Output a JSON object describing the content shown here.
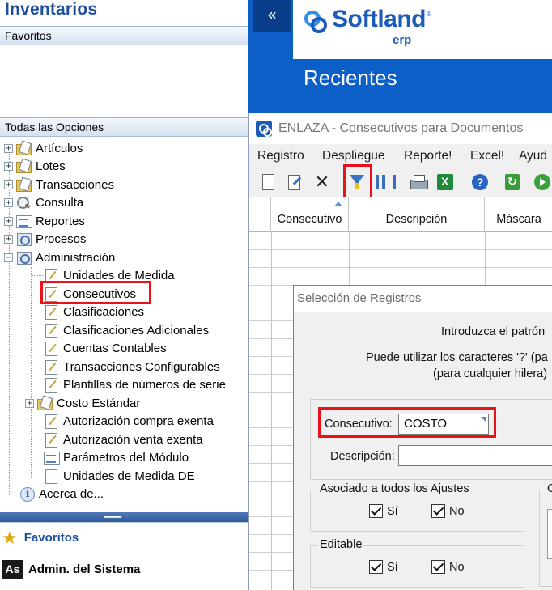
{
  "left_panel": {
    "app_title": "Inventarios",
    "favorites_header": "Favoritos",
    "all_options_header": "Todas las Opciones",
    "tree": [
      {
        "label": "Artículos",
        "expander": "+",
        "icon": "folder-doc-icon"
      },
      {
        "label": "Lotes",
        "expander": "+",
        "icon": "folder-doc-icon"
      },
      {
        "label": "Transacciones",
        "expander": "+",
        "icon": "folder-doc-icon"
      },
      {
        "label": "Consulta",
        "expander": "+",
        "icon": "search-icon"
      },
      {
        "label": "Reportes",
        "expander": "+",
        "icon": "report-icon"
      },
      {
        "label": "Procesos",
        "expander": "+",
        "icon": "gear-icon"
      },
      {
        "label": "Administración",
        "expander": "−",
        "icon": "settings-icon"
      }
    ],
    "admin_children": [
      {
        "label": "Unidades de Medida",
        "icon": "edit-doc-icon"
      },
      {
        "label": "Consecutivos",
        "icon": "edit-doc-icon",
        "highlighted": true
      },
      {
        "label": "Clasificaciones",
        "icon": "edit-doc-icon"
      },
      {
        "label": "Clasificaciones Adicionales",
        "icon": "edit-doc-icon"
      },
      {
        "label": "Cuentas Contables",
        "icon": "edit-doc-icon"
      },
      {
        "label": "Transacciones Configurables",
        "icon": "edit-doc-icon"
      },
      {
        "label": "Plantillas de números de serie",
        "icon": "edit-doc-icon"
      },
      {
        "label": "Costo Estándar",
        "icon": "folder-doc-icon",
        "expander": "+"
      },
      {
        "label": "Autorización compra exenta",
        "icon": "edit-doc-icon"
      },
      {
        "label": "Autorización venta exenta",
        "icon": "edit-doc-icon"
      },
      {
        "label": "Parámetros del Módulo",
        "icon": "settings-doc-icon"
      },
      {
        "label": "Unidades de Medida DE",
        "icon": "blank-doc-icon"
      }
    ],
    "about": {
      "label": "Acerca de...",
      "icon": "info-icon"
    },
    "splitter_dots": "••••••••••",
    "bottom": [
      {
        "label": "Favoritos",
        "icon": "star-icon"
      },
      {
        "label": "Admin. del Sistema",
        "icon_text": "As"
      }
    ]
  },
  "header": {
    "collapse_glyph": "«",
    "logo_text": "Softland",
    "logo_tm": "®",
    "logo_sub": "erp",
    "section_title": "Recientes"
  },
  "enlaza_window": {
    "title": "ENLAZA - Consecutivos para Documentos",
    "menu": [
      "Registro",
      "Despliegue",
      "Reporte!",
      "Excel!",
      "Ayud"
    ],
    "toolbar": [
      "new-icon",
      "edit-icon",
      "delete-icon",
      "filter-icon",
      "columns-icon",
      "print-icon",
      "excel-icon",
      "help-icon",
      "refresh-icon",
      "next-icon"
    ],
    "toolbar_delete_glyph": "✕",
    "columns": [
      "Consecutivo",
      "Descripción",
      "Máscara"
    ]
  },
  "dialog": {
    "title": "Selección de Registros",
    "line1": "Introduzca el patrón",
    "line2": "Puede utilizar los caracteres '?' (pa",
    "line3": "(para cualquier hilera)",
    "consecutivo_label": "Consecutivo:",
    "consecutivo_value": "COSTO",
    "descripcion_label": "Descripción:",
    "descripcion_value": "",
    "group1": {
      "label": "Asociado a todos los Ajustes",
      "yes": "Sí",
      "no": "No",
      "yes_checked": true,
      "no_checked": true
    },
    "group2": {
      "label": "Editable",
      "yes": "Sí",
      "no": "No",
      "yes_checked": true,
      "no_checked": true
    },
    "group3_label": "C"
  },
  "colors": {
    "brand_blue": "#0d5fc8",
    "title_blue": "#1f4f9d",
    "highlight_red": "#e8121b"
  }
}
